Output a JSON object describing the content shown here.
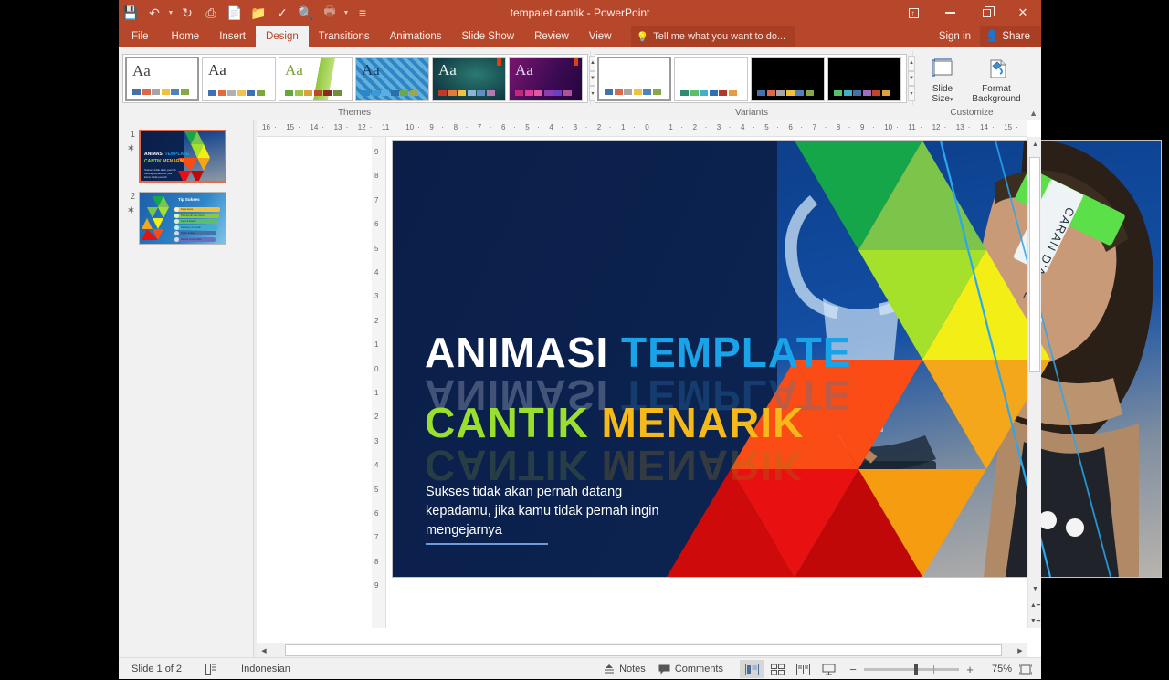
{
  "window": {
    "title": "tempalet cantik - PowerPoint",
    "controls": {
      "ribbon_display": "ribbon-display-options",
      "minimize": "—",
      "restore": "restore",
      "close": "✕"
    }
  },
  "quick_access": [
    {
      "name": "save-icon",
      "glyph": "💾"
    },
    {
      "name": "undo-icon",
      "glyph": "↶",
      "caret": true
    },
    {
      "name": "redo-icon",
      "glyph": "↻"
    },
    {
      "name": "start-from-beginning-icon",
      "glyph": "⎙"
    },
    {
      "name": "new-icon",
      "glyph": "📄"
    },
    {
      "name": "open-icon",
      "glyph": "📁"
    },
    {
      "name": "spelling-icon",
      "glyph": "✓"
    },
    {
      "name": "print-preview-icon",
      "glyph": "🔍"
    },
    {
      "name": "print-icon",
      "glyph": "🖶",
      "caret": true,
      "dim": true
    },
    {
      "name": "customize-qat-icon",
      "glyph": "≡"
    }
  ],
  "tabs": [
    {
      "label": "File",
      "active": false,
      "file": true
    },
    {
      "label": "Home",
      "active": false
    },
    {
      "label": "Insert",
      "active": false
    },
    {
      "label": "Design",
      "active": true
    },
    {
      "label": "Transitions",
      "active": false
    },
    {
      "label": "Animations",
      "active": false
    },
    {
      "label": "Slide Show",
      "active": false
    },
    {
      "label": "Review",
      "active": false
    },
    {
      "label": "View",
      "active": false
    }
  ],
  "tell_me": {
    "placeholder": "Tell me what you want to do...",
    "icon": "lightbulb-icon"
  },
  "account": {
    "sign_in": "Sign in",
    "share": "Share",
    "share_icon": "share-person-icon"
  },
  "ribbon": {
    "themes": {
      "label": "Themes",
      "items": [
        {
          "aa": "Aa",
          "bg": "#ffffff",
          "aa_color": "#444444",
          "selected": true,
          "swatches": [
            "#4472a8",
            "#d9694a",
            "#a5a5a5",
            "#f0c040",
            "#4f81bd",
            "#8aa64a"
          ]
        },
        {
          "aa": "Aa",
          "bg": "#ffffff",
          "aa_color": "#333333",
          "selected": false,
          "swatches": [
            "#3f6fb5",
            "#e06a3c",
            "#b0b0b0",
            "#f2c14e",
            "#3f6fb5",
            "#7aa83f"
          ]
        },
        {
          "aa": "Aa",
          "bg": "#ffffff",
          "aa_color": "#76a23c",
          "selected": false,
          "style": "green-wave",
          "swatches": [
            "#63a83c",
            "#9cc44a",
            "#d8a43a",
            "#c0452a",
            "#8a2b22",
            "#6d8f3a"
          ]
        },
        {
          "aa": "Aa",
          "bg": "#2f86c5",
          "aa_color": "#103a5c",
          "selected": false,
          "style": "blue-grid",
          "swatches": [
            "#2f86c5",
            "#3f9ad4",
            "#57b0e0",
            "#2c6fa8",
            "#6aa84f",
            "#9aa84f"
          ]
        },
        {
          "aa": "Aa",
          "bg": "#174a52",
          "aa_color": "#e8f2f0",
          "selected": false,
          "style": "teal-dark",
          "swatches": [
            "#c0392b",
            "#e07b39",
            "#f0c040",
            "#8ab4d8",
            "#5f8ec0",
            "#b07bb0"
          ],
          "mark": true
        },
        {
          "aa": "Aa",
          "bg": "#4b1060",
          "aa_color": "#e6d6ee",
          "selected": false,
          "style": "purple-dark",
          "swatches": [
            "#c0297a",
            "#d8409a",
            "#e05aa0",
            "#8a3fb0",
            "#6a3fc0",
            "#b04f9a"
          ],
          "mark": true
        }
      ]
    },
    "variants": {
      "label": "Variants",
      "items": [
        {
          "bg": "#ffffff",
          "selected": true,
          "swatches": [
            "#4472a8",
            "#d9694a",
            "#a5a5a5",
            "#f0c040",
            "#4f81bd",
            "#8aa64a"
          ]
        },
        {
          "bg": "#ffffff",
          "selected": false,
          "swatches": [
            "#2e8b72",
            "#5bbf6a",
            "#3fb0c8",
            "#2f6fb5",
            "#b03a2a",
            "#e0a040"
          ]
        },
        {
          "bg": "#000000",
          "selected": false,
          "swatches": [
            "#4472a8",
            "#d9694a",
            "#a5a5a5",
            "#f0c040",
            "#4f81bd",
            "#8aa64a"
          ]
        },
        {
          "bg": "#000000",
          "selected": false,
          "swatches": [
            "#5bbf6a",
            "#3fb0c8",
            "#4472a8",
            "#9a6fc0",
            "#c0452a",
            "#e0a040"
          ]
        }
      ]
    },
    "customize": {
      "label": "Customize",
      "slide_size": {
        "line1": "Slide",
        "line2": "Size",
        "icon": "slide-size-icon",
        "caret": "▾"
      },
      "format_background": {
        "line1": "Format",
        "line2": "Background",
        "icon": "format-background-icon"
      }
    },
    "collapse": "collapse-ribbon-icon"
  },
  "rulers": {
    "horizontal": [
      "16",
      "15",
      "14",
      "13",
      "12",
      "11",
      "10",
      "9",
      "8",
      "7",
      "6",
      "5",
      "4",
      "3",
      "2",
      "1",
      "0",
      "1",
      "2",
      "3",
      "4",
      "5",
      "6",
      "7",
      "8",
      "9",
      "10",
      "11",
      "12",
      "13",
      "14",
      "15",
      "16"
    ],
    "vertical": [
      "9",
      "8",
      "7",
      "6",
      "5",
      "4",
      "3",
      "2",
      "1",
      "0",
      "1",
      "2",
      "3",
      "4",
      "5",
      "6",
      "7",
      "8",
      "9"
    ]
  },
  "slides": [
    {
      "number": "1",
      "star": "✶",
      "active": true,
      "name": "slide-thumbnail-1"
    },
    {
      "number": "2",
      "star": "✶",
      "active": false,
      "name": "slide-thumbnail-2",
      "heading": "Tip Sukses",
      "bullets": [
        "Kerja keras",
        "Percaya diri dan tekun",
        "Jujur & disiplin",
        "Pantang menyerah",
        "Selalu belajar",
        "Berdoa & bersyukur"
      ]
    }
  ],
  "slide_content": {
    "title_line1_part1": "ANIMASI",
    "title_line1_part2": "TEMPLATE",
    "title_line2_part1": "CANTIK",
    "title_line2_part2": "MENARIK",
    "subtitle": "Sukses tidak akan pernah datang kepadamu, jika kamu tidak pernah ingin mengejarnya",
    "headband_text": "CARAN D'ACHE",
    "colors": {
      "part1": "#ffffff",
      "part2": "#19a3e8",
      "part3": "#9ade2e",
      "part4": "#f5b91a",
      "background": "#071a3c",
      "accent_line": "#2aa7ef"
    }
  },
  "status_bar": {
    "slide_counter": "Slide 1 of 2",
    "notes_icon": "notes-page-icon",
    "language": "Indonesian",
    "notes": "Notes",
    "comments": "Comments",
    "notes_btn_icon": "notes-icon",
    "comments_btn_icon": "comment-icon",
    "views": [
      {
        "name": "normal-view-button",
        "active": true
      },
      {
        "name": "slide-sorter-view-button",
        "active": false
      },
      {
        "name": "reading-view-button",
        "active": false
      },
      {
        "name": "slide-show-button",
        "active": false
      }
    ],
    "zoom_out": "−",
    "zoom_in": "+",
    "zoom_level": "75%",
    "fit_icon": "fit-slide-to-window-icon"
  }
}
